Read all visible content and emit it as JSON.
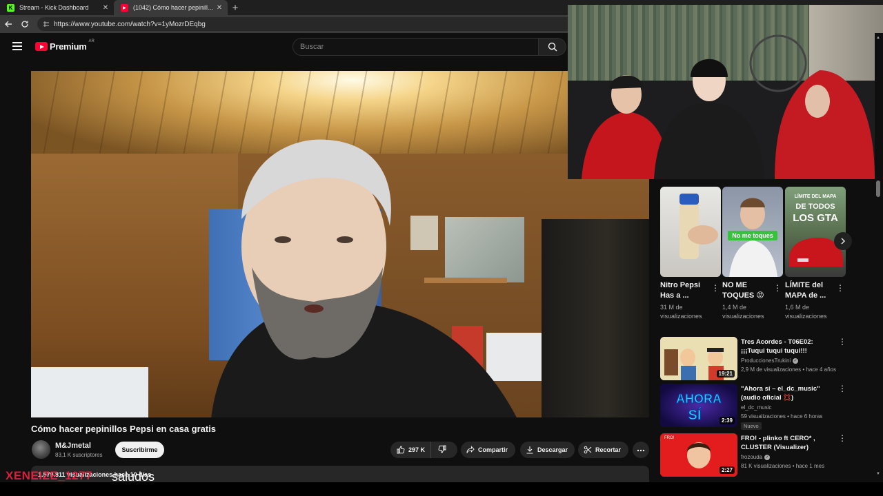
{
  "browser": {
    "tabs": [
      {
        "title": "Stream - Kick Dashboard",
        "favicon": "kick-icon",
        "active": false
      },
      {
        "title": "(1042) Cómo hacer pepinillos Pepsi en casa gratis",
        "favicon": "youtube-icon",
        "active": true
      }
    ],
    "url": "https://www.youtube.com/watch?v=1yMozrDEqbg"
  },
  "youtube": {
    "logo_text": "Premium",
    "country_code": "AR",
    "search_placeholder": "Buscar"
  },
  "video": {
    "title": "Cómo hacer pepinillos Pepsi en casa gratis",
    "channel": "M&Jmetal",
    "subscribers": "83,1 K suscriptores",
    "subscribe_label": "Suscribirme",
    "likes": "297 K",
    "share_label": "Compartir",
    "download_label": "Descargar",
    "clip_label": "Recortar",
    "description_preview": "1.579.811 visualizaciones hace 10 días"
  },
  "stream_overlay": {
    "chat_user": "XENEIZE_1277",
    "chat_message": "saludos"
  },
  "shorts": [
    {
      "title": "Nitro Pepsi Has a ...",
      "views": "31 M de visualizaciones",
      "thumb_text": ""
    },
    {
      "title": "NO ME TOQUES 😡",
      "views": "1,4 M de visualizaciones",
      "thumb_text": "No me toques"
    },
    {
      "title": "LÍMITE del MAPA de ...",
      "views": "1,6 M de visualizaciones",
      "thumb_text": "LÍMITE DEL MAPA DE TODOS LOS GTA"
    }
  ],
  "recommendations": [
    {
      "title": "Tres Acordes - T06E02: ¡¡¡Tuqui tuqui tuqui!!!",
      "channel": "ProduccionesTrukini",
      "verified": true,
      "meta": "2,9 M de visualizaciones • hace 4 años",
      "duration": "19:21",
      "badge": ""
    },
    {
      "title": "\"Ahora sí – el_dc_music\"(audio oficial 💢)",
      "channel": "el_dc_music",
      "verified": false,
      "meta": "59 visualizaciones • hace 6 horas",
      "duration": "2:39",
      "badge": "Nuevo",
      "thumb_text": "AHORA SÍ"
    },
    {
      "title": "FRO! - plinko ft CERO* , CLUSTER (Visualizer)",
      "channel": "frozouda",
      "verified": true,
      "meta": "81 K visualizaciones • hace 1 mes",
      "duration": "2:27",
      "badge": ""
    }
  ],
  "colors": {
    "yt_red": "#ff0033",
    "kick_green": "#53fc18",
    "background": "#0f0f0f",
    "chip": "#272727",
    "overlay_name": "#ff2244"
  }
}
